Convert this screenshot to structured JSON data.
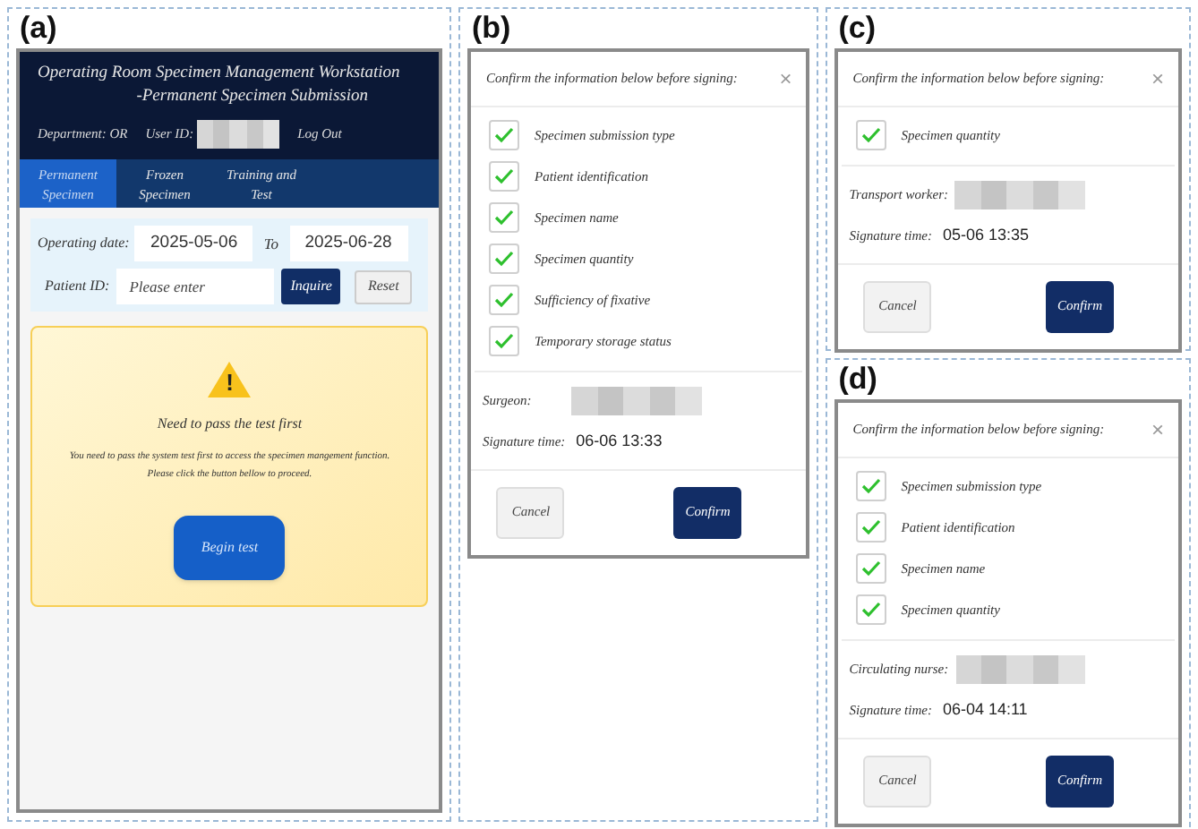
{
  "panels": [
    {
      "label": "(a)",
      "kind": "workstation",
      "header": {
        "title_line_1": "Operating Room Specimen Management Workstation",
        "title_line_2": "-Permanent Specimen Submission",
        "department": "Department: OR",
        "user_id_label": "User ID:",
        "user_id_redacted": true,
        "logout": "Log Out"
      },
      "tabs": [
        {
          "label": "Permanent Specimen",
          "selected": true
        },
        {
          "label": "Frozen Specimen",
          "selected": false
        },
        {
          "label": "Training and Test",
          "selected": false
        }
      ],
      "filters": {
        "date_label": "Operating date:",
        "date_from": "2025-05-06",
        "to_label": "To",
        "date_to": "2025-06-28",
        "patient_label": "Patient ID:",
        "patient_placeholder": "Please enter",
        "inquire": "Inquire",
        "reset": "Reset"
      },
      "notice": {
        "icon": "!",
        "title": "Need to pass the test first",
        "message_line_1": "You need to pass the system test first to access the specimen mangement function.",
        "message_line_2": "Please click the button bellow to proceed.",
        "button": "Begin test"
      }
    },
    {
      "label": "(b)",
      "kind": "dialog",
      "title": "Confirm the information below before signing:",
      "close": "×",
      "items": [
        {
          "label": "Specimen submission type",
          "checked": true
        },
        {
          "label": "Patient identification",
          "checked": true
        },
        {
          "label": "Specimen name",
          "checked": true
        },
        {
          "label": "Specimen quantity",
          "checked": true
        },
        {
          "label": "Sufficiency of fixative",
          "checked": true
        },
        {
          "label": "Temporary storage status",
          "checked": true
        }
      ],
      "signer_label": "Surgeon:",
      "signer_redacted": true,
      "time_label": "Signature time:",
      "time": "06-06 13:33",
      "cancel": "Cancel",
      "confirm": "Confirm"
    },
    {
      "label": "(c)",
      "kind": "dialog",
      "title": "Confirm the information below before signing:",
      "close": "×",
      "items": [
        {
          "label": "Specimen quantity",
          "checked": true
        }
      ],
      "signer_label": "Transport worker:",
      "signer_redacted": true,
      "time_label": "Signature time:",
      "time": "05-06 13:35",
      "cancel": "Cancel",
      "confirm": "Confirm"
    },
    {
      "label": "(d)",
      "kind": "dialog",
      "title": "Confirm the information below before signing:",
      "close": "×",
      "items": [
        {
          "label": "Specimen submission type",
          "checked": true
        },
        {
          "label": "Patient identification",
          "checked": true
        },
        {
          "label": "Specimen name",
          "checked": true
        },
        {
          "label": "Specimen quantity",
          "checked": true
        }
      ],
      "signer_label": "Circulating nurse:",
      "signer_redacted": true,
      "time_label": "Signature time:",
      "time": "06-04 14:11",
      "cancel": "Cancel",
      "confirm": "Confirm"
    }
  ]
}
